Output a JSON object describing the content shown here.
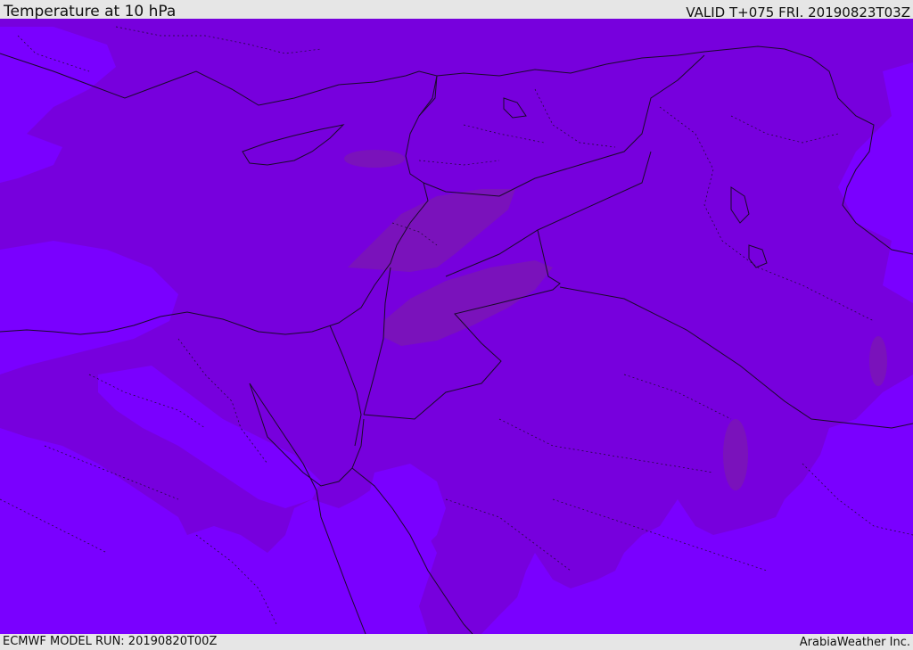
{
  "header": {
    "title": "Temperature at 10 hPa",
    "valid": "VALID T+075 FRI. 20190823T03Z"
  },
  "footer": {
    "model_run": "ECMWF MODEL RUN: 20190820T00Z",
    "credit": "ArabiaWeather Inc."
  },
  "colors": {
    "cold": "#7a00ff",
    "mid": "#7700dd",
    "warm": "#7a12bb",
    "border": "#1a0a2a"
  }
}
